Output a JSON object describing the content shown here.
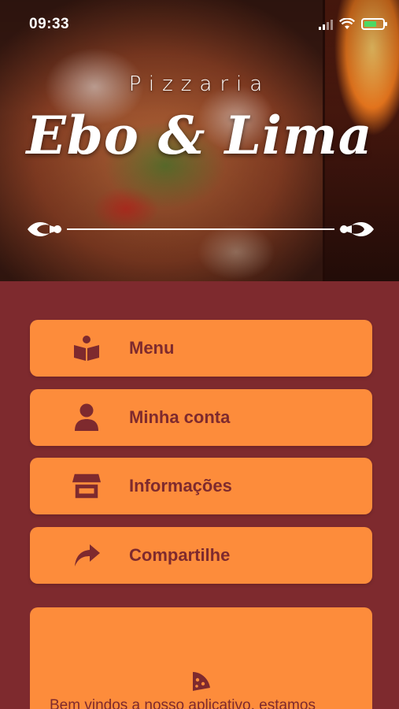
{
  "status_bar": {
    "time": "09:33",
    "signal_icon": "cellular-signal-icon",
    "wifi_icon": "wifi-icon",
    "battery_icon": "battery-charging-icon"
  },
  "brand": {
    "subtitle": "Pizzaria",
    "title": "Ebo & Lima",
    "divider_icon": "flourish-ornament-icon"
  },
  "colors": {
    "background": "#7e2a2e",
    "button": "#fd8c3b",
    "button_text": "#7e2a2e"
  },
  "menu": {
    "items": [
      {
        "label": "Menu",
        "icon": "open-book-icon"
      },
      {
        "label": "Minha conta",
        "icon": "user-icon"
      },
      {
        "label": "Informações",
        "icon": "store-icon"
      },
      {
        "label": "Compartilhe",
        "icon": "share-arrow-icon"
      }
    ]
  },
  "welcome": {
    "icon": "pizza-slice-icon",
    "text": "Bem vindos a nosso aplicativo, estamos"
  }
}
